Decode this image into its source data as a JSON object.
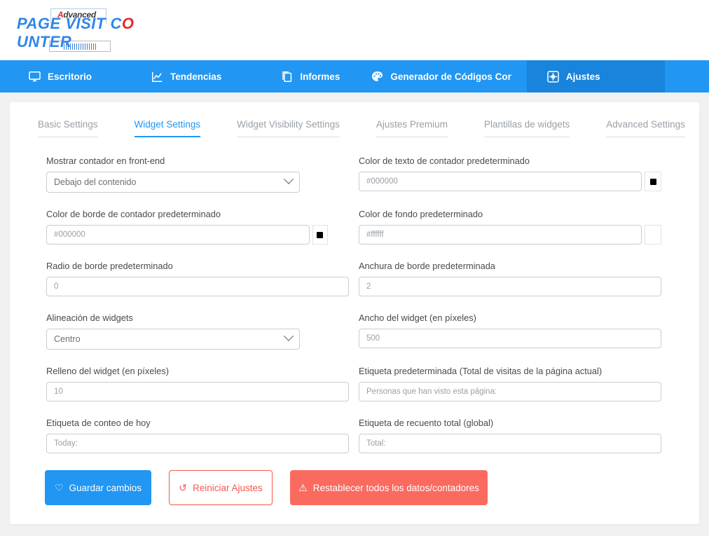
{
  "logo": {
    "badge_text_prefix": "A",
    "badge_text_rest": "dvanced",
    "title_part1": "PAGE VISIT C",
    "title_part2": "O",
    "title_part3": "UNTER"
  },
  "topnav": {
    "items": [
      {
        "label": "Escritorio",
        "icon": "monitor-icon",
        "active": false
      },
      {
        "label": "Tendencias",
        "icon": "chart-line-icon",
        "active": false
      },
      {
        "label": "Informes",
        "icon": "documents-icon",
        "active": false
      },
      {
        "label": "Generador de Códigos Cor",
        "icon": "palette-icon",
        "active": false
      },
      {
        "label": "Ajustes",
        "icon": "gear-square-icon",
        "active": true
      }
    ]
  },
  "subtabs": [
    {
      "label": "Basic Settings",
      "active": false
    },
    {
      "label": "Widget Settings",
      "active": true
    },
    {
      "label": "Widget Visibility Settings",
      "active": false
    },
    {
      "label": "Ajustes Premium",
      "active": false
    },
    {
      "label": "Plantillas de widgets",
      "active": false
    },
    {
      "label": "Advanced Settings",
      "active": false
    }
  ],
  "fields": {
    "show_counter": {
      "label": "Mostrar contador en front-end",
      "value": "Debajo del contenido"
    },
    "text_color": {
      "label": "Color de texto de contador predeterminado",
      "value": "#000000",
      "swatch": "#000000"
    },
    "border_color": {
      "label": "Color de borde de contador predeterminado",
      "value": "#000000",
      "swatch": "#000000"
    },
    "background_color": {
      "label": "Color de fondo predeterminado",
      "value": "#ffffff",
      "swatch": "#ffffff"
    },
    "border_radius": {
      "label": "Radio de borde predeterminado",
      "value": "0"
    },
    "border_width": {
      "label": "Anchura de borde predeterminada",
      "value": "2"
    },
    "widget_alignment": {
      "label": "Alineación de widgets",
      "value": "Centro"
    },
    "widget_width": {
      "label": "Ancho del widget (en píxeles)",
      "value": "500"
    },
    "widget_padding": {
      "label": "Relleno del widget (en píxeles)",
      "value": "10"
    },
    "default_label": {
      "label": "Etiqueta predeterminada (Total de visitas de la página actual)",
      "value": "Personas que han visto esta página:"
    },
    "today_label": {
      "label": "Etiqueta de conteo de hoy",
      "value": "Today:"
    },
    "total_label": {
      "label": "Etiqueta de recuento total (global)",
      "value": "Total:"
    }
  },
  "buttons": {
    "save": {
      "label": "Guardar cambios",
      "icon": "heart-icon",
      "glyph": "♡"
    },
    "reset_settings": {
      "label": "Reiniciar Ajustes",
      "icon": "refresh-icon",
      "glyph": "↺"
    },
    "reset_all": {
      "label": "Restablecer todos los datos/contadores",
      "icon": "warning-icon",
      "glyph": "⚠"
    }
  },
  "colors": {
    "brand_blue": "#2196f3",
    "active_nav": "#1884db",
    "danger": "#fb6a5f",
    "outline_red": "#f4584e"
  }
}
